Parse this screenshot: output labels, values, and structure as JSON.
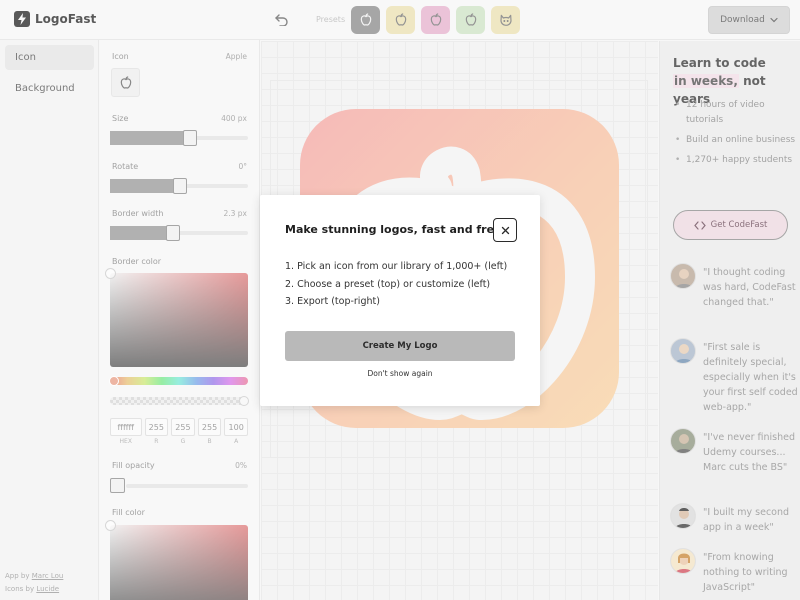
{
  "app": {
    "name": "LogoFast"
  },
  "header": {
    "presets_label": "Presets",
    "presets": [
      {
        "icon": "apple-icon",
        "bg": "#8d8d8d",
        "fg": "#f0f0f0"
      },
      {
        "icon": "apple-icon",
        "bg": "#ebe0b2",
        "fg": "#777"
      },
      {
        "icon": "apple-icon",
        "bg": "#e6b3cd",
        "fg": "#777"
      },
      {
        "icon": "apple-icon",
        "bg": "#cfe3c6",
        "fg": "#777"
      },
      {
        "icon": "cat-icon",
        "bg": "#ebe0b2",
        "fg": "#777"
      }
    ],
    "download_label": "Download"
  },
  "sidebar": {
    "items": [
      {
        "label": "Icon",
        "active": true
      },
      {
        "label": "Background",
        "active": false
      }
    ],
    "credits": {
      "app_by": "App by",
      "app_author": "Marc Lou",
      "icons_by": "Icons by",
      "icons_source": "Lucide"
    }
  },
  "controls": {
    "icon": {
      "label": "Icon",
      "value": "Apple"
    },
    "size": {
      "label": "Size",
      "value": "400 px",
      "fraction": 0.59
    },
    "rotate": {
      "label": "Rotate",
      "value": "0°",
      "fraction": 0.51
    },
    "border_width": {
      "label": "Border width",
      "value": "2.3 px",
      "fraction": 0.45
    },
    "border_color": {
      "label": "Border color",
      "hex": "ffffff",
      "r": "255",
      "g": "255",
      "b": "255",
      "a": "100",
      "hex_label": "HEX",
      "r_label": "R",
      "g_label": "G",
      "b_label": "B",
      "a_label": "A"
    },
    "fill_opacity": {
      "label": "Fill opacity",
      "value": "0%"
    },
    "fill_color": {
      "label": "Fill color"
    }
  },
  "modal": {
    "title": "Make stunning logos, fast and free!",
    "steps": [
      "1. Pick an icon from our library of 1,000+ (left)",
      "2. Choose a preset (top) or customize (left)",
      "3. Export (top-right)"
    ],
    "cta": "Create My Logo",
    "dismiss": "Don't show again"
  },
  "promo": {
    "title_pre": "Learn to code",
    "title_highlight": "in weeks,",
    "title_post": "not years",
    "bullets": [
      "12 hours of video tutorials",
      "Build an online business",
      "1,270+ happy students"
    ],
    "button": "Get CodeFast"
  },
  "testimonials": [
    {
      "quote": "\"I thought coding was hard, CodeFast changed that.\""
    },
    {
      "quote": "\"First sale is definitely special, especially when it's your first self coded web-app.\""
    },
    {
      "quote": "\"I've never finished Udemy courses... Marc cuts the BS\""
    },
    {
      "quote": "\"I built my second app in a week\""
    },
    {
      "quote": "\"From knowing nothing to writing JavaScript\""
    }
  ],
  "colors": {
    "tile_gradient_start": "#f4a7a4",
    "tile_gradient_end": "#f8d3a3",
    "accent_pink": "#f1dde6"
  }
}
